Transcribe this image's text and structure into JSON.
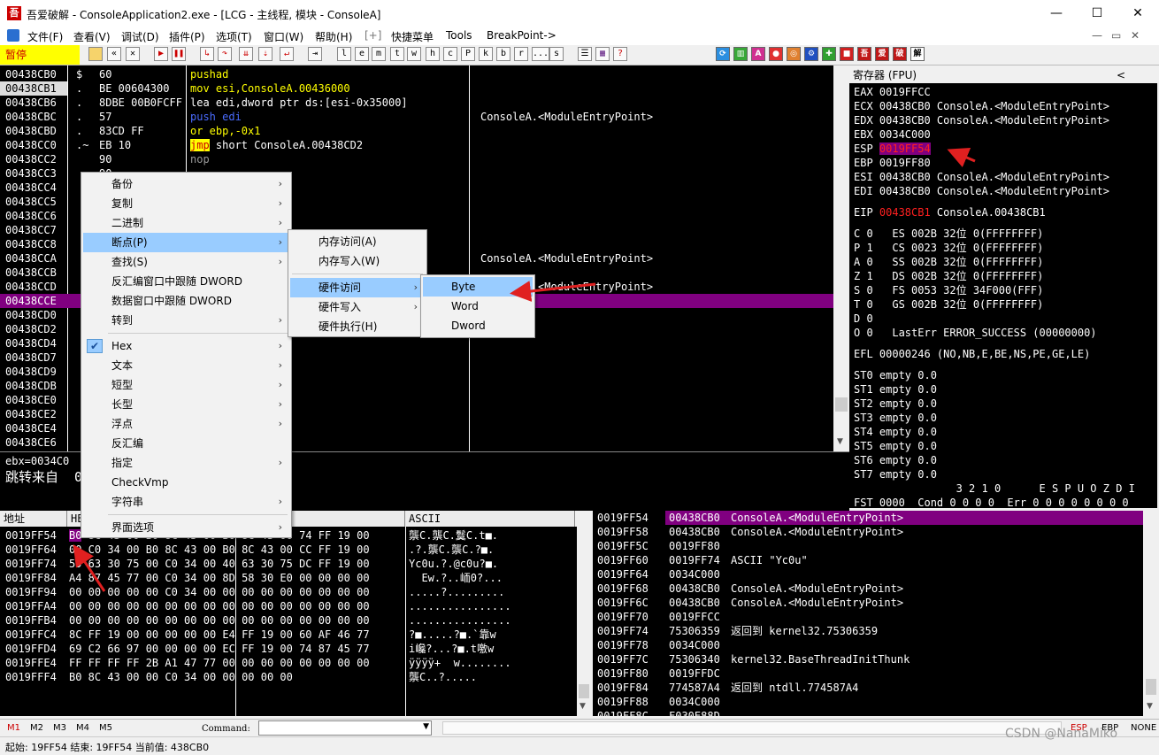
{
  "window": {
    "title": "吾爱破解 - ConsoleApplication2.exe - [LCG - 主线程, 模块 - ConsoleA]",
    "icon_text": "吾",
    "controls": {
      "minimize": "—",
      "maximize": "☐",
      "close": "✕"
    }
  },
  "menu": {
    "items": [
      "文件(F)",
      "查看(V)",
      "调试(D)",
      "插件(P)",
      "选项(T)",
      "窗口(W)",
      "帮助(H)",
      "[+]",
      "快捷菜单",
      "Tools",
      "BreakPoint->"
    ],
    "mdi_controls": [
      "—",
      "▭",
      "✕"
    ]
  },
  "toolbar": {
    "status": "暂停",
    "letters": [
      "l",
      "e",
      "m",
      "t",
      "w",
      "h",
      "c",
      "P",
      "k",
      "b",
      "r",
      "...",
      "s"
    ],
    "right_labels": [
      "吾",
      "爱",
      "破",
      "解"
    ]
  },
  "cpu": {
    "rows": [
      {
        "addr": "00438CB0",
        "mark": "$",
        "hex": "60",
        "asm": "pushad",
        "comment": ""
      },
      {
        "addr": "00438CB1",
        "mark": ".",
        "hex": "BE 00604300",
        "asm": "mov esi,ConsoleA.00436000",
        "comment": ""
      },
      {
        "addr": "00438CB6",
        "mark": ".",
        "hex": "8DBE 00B0FCFF",
        "asm": "lea edi,dword ptr ds:[esi-0x35000]",
        "comment": ""
      },
      {
        "addr": "00438CBC",
        "mark": ".",
        "hex": "57",
        "asm": "push edi",
        "comment": "ConsoleA.<ModuleEntryPoint>"
      },
      {
        "addr": "00438CBD",
        "mark": ".",
        "hex": "83CD FF",
        "asm": "or ebp,-0x1",
        "comment": ""
      },
      {
        "addr": "00438CC0",
        "mark": ".~",
        "hex": "EB 10",
        "asm": "jmp short ConsoleA.00438CD2",
        "comment": ""
      },
      {
        "addr": "00438CC2",
        "mark": "",
        "hex": "90",
        "asm": "nop",
        "comment": ""
      },
      {
        "addr": "00438CC3",
        "mark": "",
        "hex": "90",
        "asm": "",
        "comment": ""
      },
      {
        "addr": "00438CC4",
        "mark": "",
        "hex": "",
        "asm": "",
        "comment": ""
      },
      {
        "addr": "00438CC5",
        "mark": "",
        "hex": "",
        "asm": "",
        "comment": ""
      },
      {
        "addr": "00438CC6",
        "mark": "",
        "hex": "",
        "asm": "",
        "comment": ""
      },
      {
        "addr": "00438CC7",
        "mark": "",
        "hex": "",
        "asm": "",
        "comment": ""
      },
      {
        "addr": "00438CC8",
        "mark": "",
        "hex": "",
        "asm": "",
        "comment": ""
      },
      {
        "addr": "00438CCA",
        "mark": "",
        "hex": "",
        "asm": "",
        "comment": "ConsoleA.<ModuleEntryPoint>"
      },
      {
        "addr": "00438CCB",
        "mark": "",
        "hex": "",
        "asm": "",
        "comment": ""
      },
      {
        "addr": "00438CCD",
        "mark": "",
        "hex": "",
        "asm": "",
        "comment": "ConsoleA.<ModuleEntryPoint>"
      },
      {
        "addr": "00438CCE",
        "mark": "",
        "hex": "",
        "asm": "",
        "comment": ""
      },
      {
        "addr": "00438CD0",
        "mark": "",
        "hex": "",
        "asm": "",
        "comment": ""
      },
      {
        "addr": "00438CD2",
        "mark": "",
        "hex": "",
        "asm": "",
        "comment": ""
      },
      {
        "addr": "00438CD4",
        "mark": "",
        "hex": "",
        "asm": "",
        "comment": ""
      },
      {
        "addr": "00438CD7",
        "mark": "",
        "hex": "",
        "asm": "",
        "comment": ""
      },
      {
        "addr": "00438CD9",
        "mark": "",
        "hex": "",
        "asm": "eA.00438CC8",
        "comment": ""
      },
      {
        "addr": "00438CDB",
        "mark": "",
        "hex": "",
        "asm": "",
        "comment": ""
      },
      {
        "addr": "00438CE0",
        "mark": "",
        "hex": "",
        "asm": "",
        "comment": ""
      },
      {
        "addr": "00438CE2",
        "mark": "",
        "hex": "",
        "asm": "leA.00438CEB",
        "comment": ""
      },
      {
        "addr": "00438CE4",
        "mark": "",
        "hex": "",
        "asm": "ptr ds:[esi]",
        "comment": ""
      },
      {
        "addr": "00438CE6",
        "mark": "",
        "hex": "",
        "asm": "",
        "comment": ""
      }
    ],
    "info1": "ebx=0034C0",
    "info2": "跳转来自  00"
  },
  "registers": {
    "header": "寄存器 (FPU)",
    "collapse": "<",
    "lines": [
      {
        "name": "EAX",
        "val": "0019FFCC",
        "desc": ""
      },
      {
        "name": "ECX",
        "val": "00438CB0",
        "desc": "ConsoleA.<ModuleEntryPoint>"
      },
      {
        "name": "EDX",
        "val": "00438CB0",
        "desc": "ConsoleA.<ModuleEntryPoint>"
      },
      {
        "name": "EBX",
        "val": "0034C000",
        "desc": ""
      },
      {
        "name": "ESP",
        "val": "0019FF54",
        "desc": ""
      },
      {
        "name": "EBP",
        "val": "0019FF80",
        "desc": ""
      },
      {
        "name": "ESI",
        "val": "00438CB0",
        "desc": "ConsoleA.<ModuleEntryPoint>"
      },
      {
        "name": "EDI",
        "val": "00438CB0",
        "desc": "ConsoleA.<ModuleEntryPoint>"
      }
    ],
    "eip": {
      "name": "EIP",
      "val": "00438CB1",
      "desc": "ConsoleA.00438CB1"
    },
    "segs": [
      "C 0   ES 002B 32位 0(FFFFFFFF)",
      "P 1   CS 0023 32位 0(FFFFFFFF)",
      "A 0   SS 002B 32位 0(FFFFFFFF)",
      "Z 1   DS 002B 32位 0(FFFFFFFF)",
      "S 0   FS 0053 32位 34F000(FFF)",
      "T 0   GS 002B 32位 0(FFFFFFFF)",
      "D 0",
      "O 0   LastErr ERROR_SUCCESS (00000000)"
    ],
    "efl": "EFL 00000246 (NO,NB,E,BE,NS,PE,GE,LE)",
    "st": [
      "ST0 empty 0.0",
      "ST1 empty 0.0",
      "ST2 empty 0.0",
      "ST3 empty 0.0",
      "ST4 empty 0.0",
      "ST5 empty 0.0",
      "ST6 empty 0.0",
      "ST7 empty 0.0"
    ],
    "fst_head": "                3 2 1 0      E S P U O Z D I",
    "fst": "FST 0000  Cond 0 0 0 0  Err 0 0 0 0 0 0 0 0"
  },
  "dump": {
    "headers": {
      "addr": "地址",
      "hex": "HE",
      "ascii": "ASCII"
    },
    "rows": [
      {
        "addr": "0019FF54",
        "hex": "B0 8C 43 00 B0 8C 43 00 B0 8C 43 00 74 FF 19 00",
        "ascii": "龒C.龒C.鬕C.t■."
      },
      {
        "addr": "0019FF64",
        "hex": "00 C0 34 00 B0 8C 43 00 B0 8C 43 00 CC FF 19 00",
        "ascii": ".?.龒C.龒C.?■."
      },
      {
        "addr": "0019FF74",
        "hex": "59 63 30 75 00 C0 34 00 40 63 30 75 DC FF 19 00",
        "ascii": "Yc0u.?.@c0u?■."
      },
      {
        "addr": "0019FF84",
        "hex": "A4 87 45 77 00 C0 34 00 8D 58 30 E0 00 00 00 00",
        "ascii": "  Ew.?..峏0?..."
      },
      {
        "addr": "0019FF94",
        "hex": "00 00 00 00 00 C0 34 00 00 00 00 00 00 00 00 00",
        "ascii": ".....?........."
      },
      {
        "addr": "0019FFA4",
        "hex": "00 00 00 00 00 00 00 00 00 00 00 00 00 00 00 00",
        "ascii": "................"
      },
      {
        "addr": "0019FFB4",
        "hex": "00 00 00 00 00 00 00 00 00 00 00 00 00 00 00 00",
        "ascii": "................"
      },
      {
        "addr": "0019FFC4",
        "hex": "8C FF 19 00 00 00 00 00 E4 FF 19 00 60 AF 46 77",
        "ascii": "?■.....?■.`靠w"
      },
      {
        "addr": "0019FFD4",
        "hex": "69 C2 66 97 00 00 00 00 EC FF 19 00 74 87 45 77",
        "ascii": "i巉?...?■.t噭w"
      },
      {
        "addr": "0019FFE4",
        "hex": "FF FF FF FF 2B A1 47 77 00 00 00 00 00 00 00 00",
        "ascii": "ÿÿÿÿ+  w........"
      },
      {
        "addr": "0019FFF4",
        "hex": "B0 8C 43 00 00 C0 34 00 00 00 00 00",
        "ascii": "龒C..?....."
      }
    ]
  },
  "stack": {
    "rows": [
      {
        "addr": "0019FF54",
        "val": "00438CB0",
        "comment": "ConsoleA.<ModuleEntryPoint>"
      },
      {
        "addr": "0019FF58",
        "val": "00438CB0",
        "comment": "ConsoleA.<ModuleEntryPoint>"
      },
      {
        "addr": "0019FF5C",
        "val": "0019FF80",
        "comment": ""
      },
      {
        "addr": "0019FF60",
        "val": "0019FF74",
        "comment": "ASCII \"Yc0u\""
      },
      {
        "addr": "0019FF64",
        "val": "0034C000",
        "comment": ""
      },
      {
        "addr": "0019FF68",
        "val": "00438CB0",
        "comment": "ConsoleA.<ModuleEntryPoint>"
      },
      {
        "addr": "0019FF6C",
        "val": "00438CB0",
        "comment": "ConsoleA.<ModuleEntryPoint>"
      },
      {
        "addr": "0019FF70",
        "val": "0019FFCC",
        "comment": ""
      },
      {
        "addr": "0019FF74",
        "val": "75306359",
        "comment": "返回到 kernel32.75306359"
      },
      {
        "addr": "0019FF78",
        "val": "0034C000",
        "comment": ""
      },
      {
        "addr": "0019FF7C",
        "val": "75306340",
        "comment": "kernel32.BaseThreadInitThunk"
      },
      {
        "addr": "0019FF80",
        "val": "0019FFDC",
        "comment": ""
      },
      {
        "addr": "0019FF84",
        "val": "774587A4",
        "comment": "返回到 ntdll.774587A4"
      },
      {
        "addr": "0019FF88",
        "val": "0034C000",
        "comment": ""
      },
      {
        "addr": "0019FF8C",
        "val": "F030E88D",
        "comment": ""
      }
    ]
  },
  "context_menu": {
    "items": [
      {
        "label": "备份",
        "sub": true
      },
      {
        "label": "复制",
        "sub": true
      },
      {
        "label": "二进制",
        "sub": true
      },
      {
        "label": "断点(P)",
        "sub": true
      },
      {
        "label": "查找(S)",
        "sub": true
      },
      {
        "label": "反汇编窗口中跟随 DWORD",
        "sub": false
      },
      {
        "label": "数据窗口中跟随 DWORD",
        "sub": false
      },
      {
        "label": "转到",
        "sub": true
      },
      {
        "label": "Hex",
        "sub": true
      },
      {
        "label": "文本",
        "sub": true
      },
      {
        "label": "短型",
        "sub": true
      },
      {
        "label": "长型",
        "sub": true
      },
      {
        "label": "浮点",
        "sub": true
      },
      {
        "label": "反汇编",
        "sub": false
      },
      {
        "label": "指定",
        "sub": true
      },
      {
        "label": "CheckVmp",
        "sub": false
      },
      {
        "label": "字符串",
        "sub": true
      },
      {
        "label": "界面选项",
        "sub": true
      }
    ],
    "checkmark": "✔",
    "arrow": "›"
  },
  "bp_menu": {
    "items": [
      "内存访问(A)",
      "内存写入(W)",
      "硬件访问",
      "硬件写入",
      "硬件执行(H)"
    ]
  },
  "hw_menu": {
    "items": [
      "Byte",
      "Word",
      "Dword"
    ]
  },
  "cmdbar": {
    "tabs": [
      "M1",
      "M2",
      "M3",
      "M4",
      "M5"
    ],
    "command_label": "Command:",
    "regs": [
      "ESP",
      "EBP",
      "NONE"
    ]
  },
  "statusbar": {
    "text": "起始: 19FF54 结束: 19FF54 当前值: 438CB0",
    "watermark": "CSDN @NanaMiko"
  },
  "colors": {
    "highlight": "#800080",
    "asm_keyword": "#ffff00",
    "red_value": "#ff2020",
    "menu_hl": "#99ccff"
  }
}
